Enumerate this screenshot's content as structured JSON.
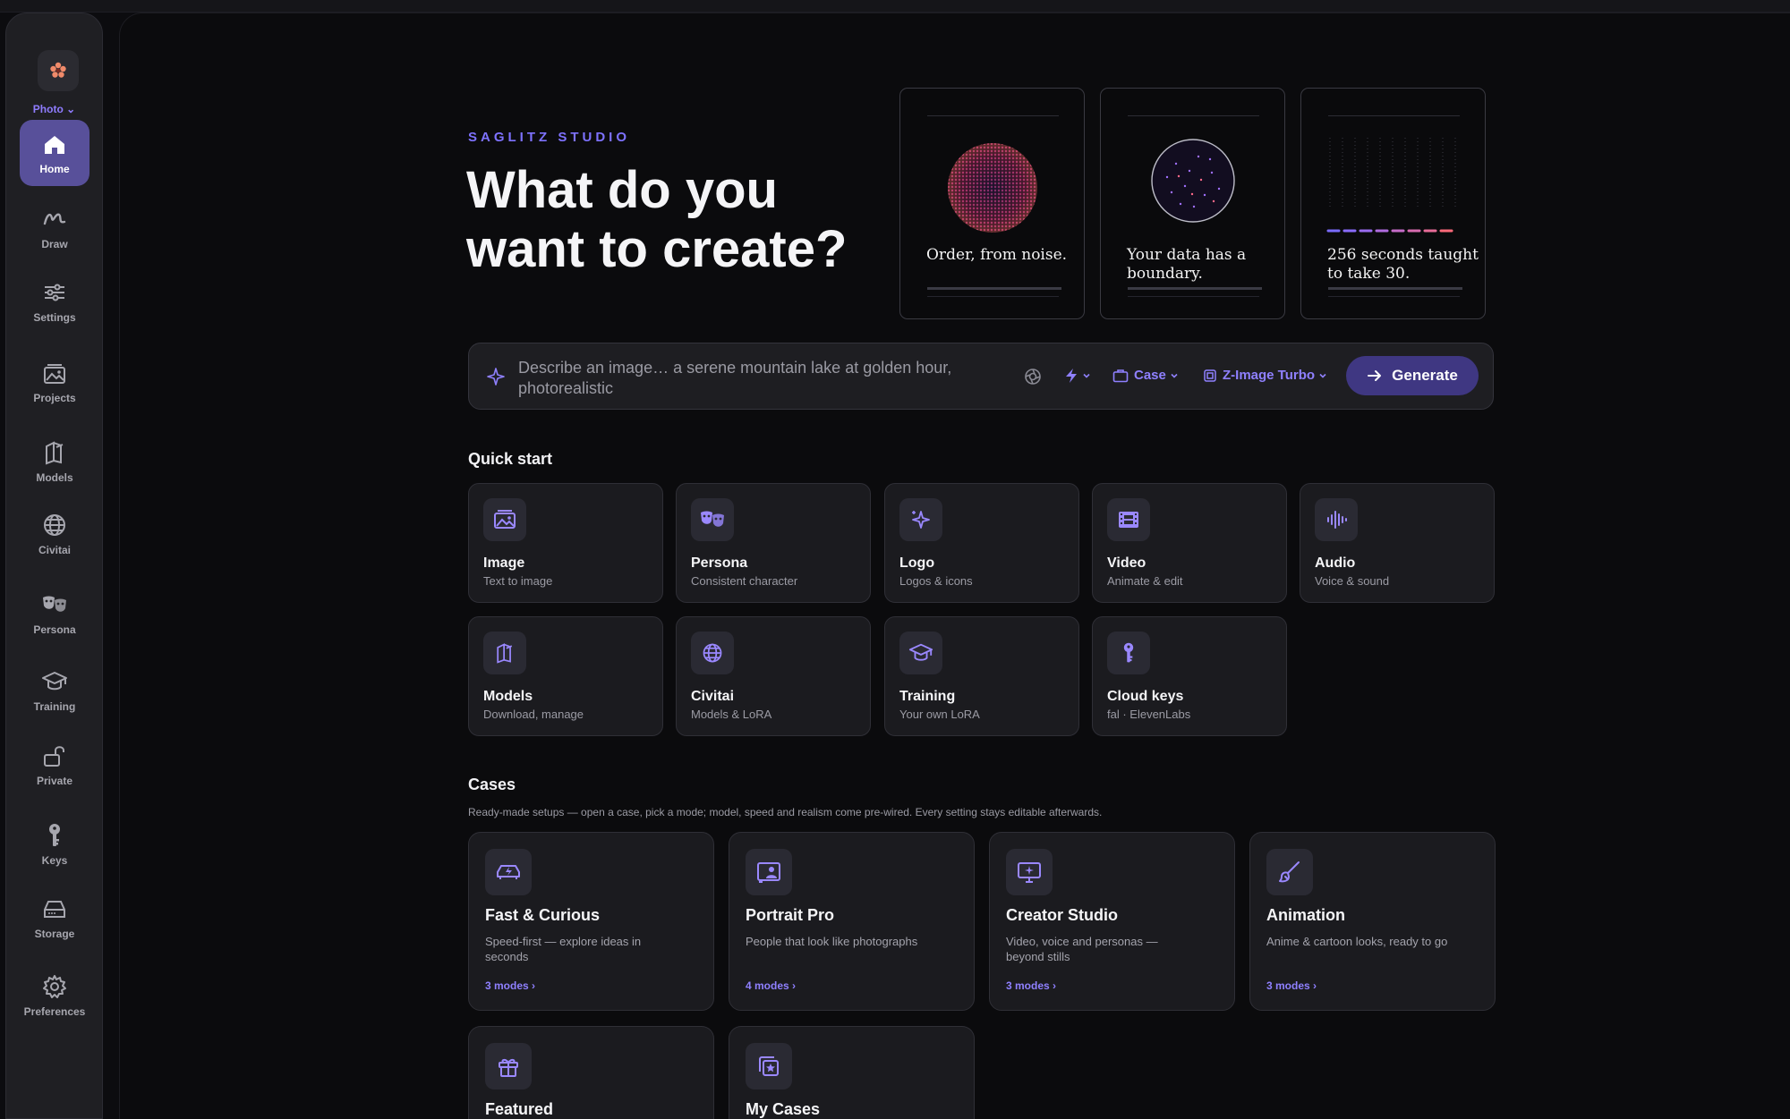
{
  "sidebar": {
    "mode_label": "Photo",
    "items": [
      {
        "label": "Home",
        "icon": "home-icon"
      },
      {
        "label": "Draw",
        "icon": "draw-icon"
      },
      {
        "label": "Settings",
        "icon": "sliders-icon"
      },
      {
        "label": "Projects",
        "icon": "projects-icon"
      },
      {
        "label": "Models",
        "icon": "models-icon"
      },
      {
        "label": "Civitai",
        "icon": "globe-icon"
      },
      {
        "label": "Persona",
        "icon": "masks-icon"
      },
      {
        "label": "Training",
        "icon": "graduation-cap-icon"
      },
      {
        "label": "Private",
        "icon": "unlock-icon"
      },
      {
        "label": "Keys",
        "icon": "key-icon"
      },
      {
        "label": "Storage",
        "icon": "storage-icon"
      },
      {
        "label": "Preferences",
        "icon": "gear-icon"
      }
    ]
  },
  "hero": {
    "brand": "SAGLITZ STUDIO",
    "headline": "What do you want to create?",
    "posters": [
      {
        "title": "Order, from noise."
      },
      {
        "title": "Your data has a boundary."
      },
      {
        "title": "256 seconds taught to take 30."
      }
    ]
  },
  "prompt": {
    "placeholder": "Describe an image… a serene mountain lake at golden hour, photorealistic",
    "case_label": "Case",
    "model_label": "Z-Image Turbo",
    "generate_label": "Generate"
  },
  "quick_start": {
    "title": "Quick start",
    "tiles": [
      {
        "title": "Image",
        "subtitle": "Text to image",
        "icon": "image-icon"
      },
      {
        "title": "Persona",
        "subtitle": "Consistent character",
        "icon": "masks-icon"
      },
      {
        "title": "Logo",
        "subtitle": "Logos & icons",
        "icon": "sparkle-icon"
      },
      {
        "title": "Video",
        "subtitle": "Animate & edit",
        "icon": "film-icon"
      },
      {
        "title": "Audio",
        "subtitle": "Voice & sound",
        "icon": "waveform-icon"
      },
      {
        "title": "Models",
        "subtitle": "Download, manage",
        "icon": "models-icon"
      },
      {
        "title": "Civitai",
        "subtitle": "Models & LoRA",
        "icon": "globe-icon"
      },
      {
        "title": "Training",
        "subtitle": "Your own LoRA",
        "icon": "graduation-cap-icon"
      },
      {
        "title": "Cloud keys",
        "subtitle": "fal · ElevenLabs",
        "icon": "key-icon"
      }
    ]
  },
  "cases": {
    "title": "Cases",
    "description": "Ready-made setups — open a case, pick a mode; model, speed and realism come pre-wired. Every setting stays editable afterwards.",
    "cards": [
      {
        "title": "Fast & Curious",
        "subtitle": "Speed-first — explore ideas in seconds",
        "modes": "3 modes ›",
        "icon": "car-icon"
      },
      {
        "title": "Portrait Pro",
        "subtitle": "People that look like photographs",
        "modes": "4 modes ›",
        "icon": "portrait-icon"
      },
      {
        "title": "Creator Studio",
        "subtitle": "Video, voice and personas — beyond stills",
        "modes": "3 modes ›",
        "icon": "monitor-icon"
      },
      {
        "title": "Animation",
        "subtitle": "Anime & cartoon looks, ready to go",
        "modes": "3 modes ›",
        "icon": "brush-icon"
      },
      {
        "title": "Featured",
        "icon": "gift-icon"
      },
      {
        "title": "My Cases",
        "icon": "star-stack-icon"
      }
    ]
  },
  "colors": {
    "accent": "#7e72ff",
    "accent_dark": "#3f3782",
    "active_nav": "#58509a"
  }
}
